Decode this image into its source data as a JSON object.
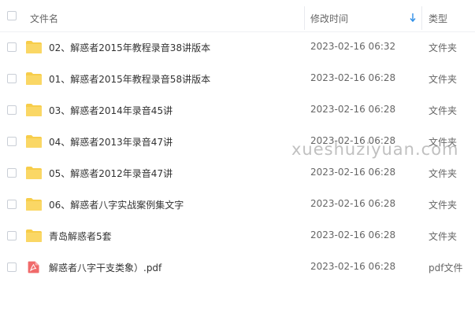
{
  "header": {
    "name_label": "文件名",
    "time_label": "修改时间",
    "type_label": "类型"
  },
  "colors": {
    "folder": "#f7cd4a",
    "pdf": "#f06a6a",
    "sort_arrow": "#2f8fe8"
  },
  "files": [
    {
      "icon": "folder-icon",
      "name": "02、解惑者2015年教程录音38讲版本",
      "time": "2023-02-16 06:32",
      "type": "文件夹"
    },
    {
      "icon": "folder-icon",
      "name": "01、解惑者2015年教程录音58讲版本",
      "time": "2023-02-16 06:28",
      "type": "文件夹"
    },
    {
      "icon": "folder-icon",
      "name": "03、解惑者2014年录音45讲",
      "time": "2023-02-16 06:28",
      "type": "文件夹"
    },
    {
      "icon": "folder-icon",
      "name": "04、解惑者2013年录音47讲",
      "time": "2023-02-16 06:28",
      "type": "文件夹"
    },
    {
      "icon": "folder-icon",
      "name": "05、解惑者2012年录音47讲",
      "time": "2023-02-16 06:28",
      "type": "文件夹"
    },
    {
      "icon": "folder-icon",
      "name": "06、解惑者八字实战案例集文字",
      "time": "2023-02-16 06:28",
      "type": "文件夹"
    },
    {
      "icon": "folder-icon",
      "name": "青岛解惑者5套",
      "time": "2023-02-16 06:28",
      "type": "文件夹"
    },
    {
      "icon": "pdf-icon",
      "name": "解惑者八字干支类象）.pdf",
      "time": "2023-02-16 06:28",
      "type": "pdf文件"
    }
  ],
  "watermark": "xueshuziyuan.com"
}
